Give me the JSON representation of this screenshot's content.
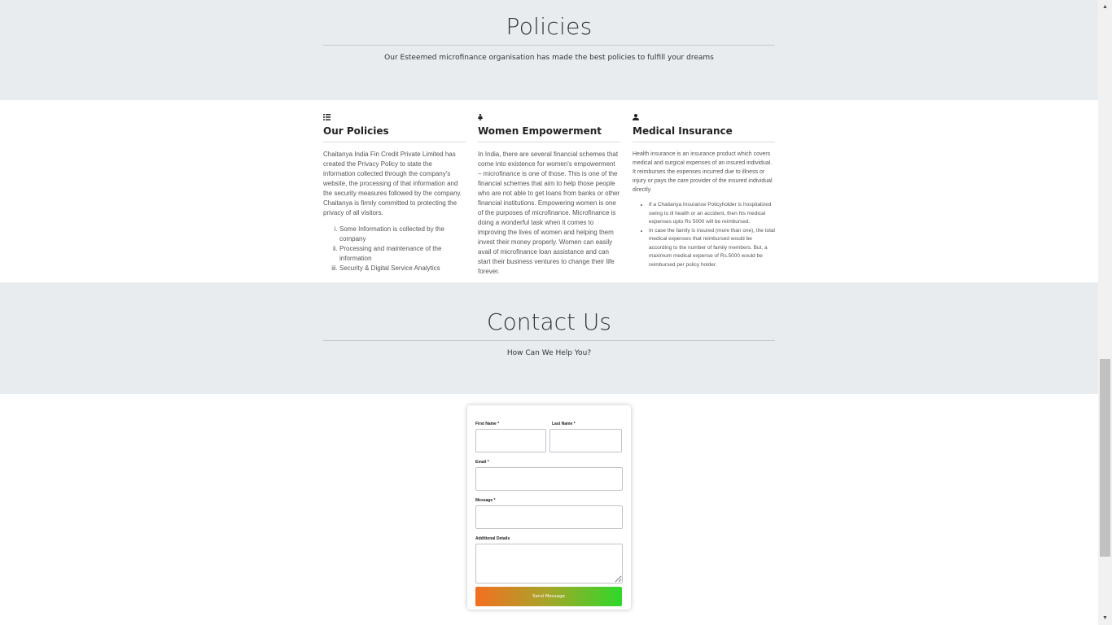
{
  "policies_section": {
    "title": "Policies",
    "subtitle": "Our Esteemed microfinance organisation has made the best policies to fulfill your dreams"
  },
  "columns": [
    {
      "icon": "list-icon",
      "title": "Our Policies",
      "paragraph": "Chaitanya India Fin Credit Private Limited has created the Privacy Policy to state the information collected through the company's website, the processing of that information and the security measures followed by the company. Chaitanya is firmly committed to protecting the privacy of all visitors.",
      "list": [
        "Some Information is collected by the company",
        "Processing and maintenance of the information",
        "Security & Digital Service Analytics"
      ]
    },
    {
      "icon": "female-icon",
      "title": "Women Empowerment",
      "paragraph": "In India, there are several financial schemes that come into existence for women's empowerment – microfinance is one of those. This is one of the financial schemes that aim to help those people who are not able to get loans from banks or other financial institutions. Empowering women is one of the purposes of microfinance. Microfinance is doing a wonderful task when it comes to improving the lives of women and helping them invest their money properly. Women can easily avail of microfinance loan assistance and can start their business ventures to change their life forever."
    },
    {
      "icon": "user-doctor-icon",
      "title": "Medical Insurance",
      "paragraph": "Health insurance is an insurance product which covers medical and surgical expenses of an insured individual. It reimburses the expenses incurred due to illness or injury or pays the care provider of the insured individual directly.",
      "list": [
        "If a Chaitanya Insurance Policyholder is hospitalized owing to ill health or an accident, then his medical expenses upto Rs 5000 will be reimbursed.",
        "In case the family is insured (more than one), the total medical expenses that reimbursed would be according to the number of family members. But, a maximum medical expense of Rs.5000 would be reimbursed per policy holder."
      ]
    }
  ],
  "contact_section": {
    "title": "Contact Us",
    "subtitle": "How Can We Help You?"
  },
  "form": {
    "first_name_label": "First Name",
    "last_name_label": "Last Name",
    "email_label": "Email",
    "message_label": "Message",
    "details_label": "Additional Details",
    "required_mark": "*",
    "send_label": "Send Message"
  },
  "scrollbar": {
    "up_icon": "triangle-up-icon",
    "down_icon": "triangle-down-icon"
  }
}
